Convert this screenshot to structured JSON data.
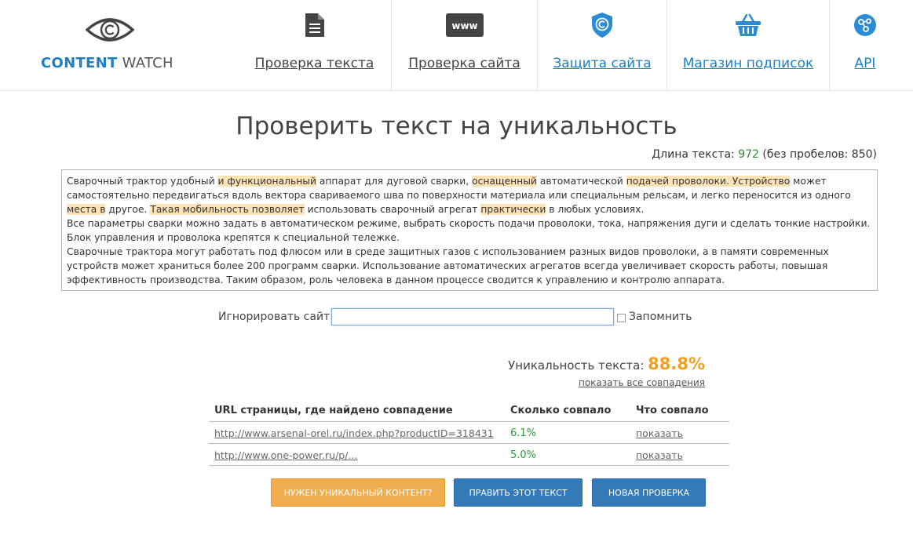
{
  "logo": {
    "part1": "CONTENT",
    "part2": " WATCH"
  },
  "nav": [
    {
      "label": "Проверка текста",
      "icon": "document-icon",
      "style": "dark"
    },
    {
      "label": "Проверка сайта",
      "icon": "www-icon",
      "style": "dark"
    },
    {
      "label": "Защита сайта",
      "icon": "shield-copyright-icon",
      "style": "blue"
    },
    {
      "label": "Магазин подписок",
      "icon": "basket-icon",
      "style": "blue"
    },
    {
      "label": "API",
      "icon": "api-nodes-icon",
      "style": "blue"
    }
  ],
  "page": {
    "title": "Проверить текст на уникальность",
    "length_label": "Длина текста: ",
    "length_value": "972",
    "length_nospace": " (без пробелов: 850)"
  },
  "text_segments": [
    {
      "t": "Сварочный трактор удобный ",
      "hl": false
    },
    {
      "t": "и функциональный",
      "hl": true
    },
    {
      "t": " аппарат для дуговой сварки, ",
      "hl": false
    },
    {
      "t": "оснащенный",
      "hl": true
    },
    {
      "t": " автоматической ",
      "hl": false
    },
    {
      "t": "подачей проволоки. Устройство",
      "hl": true
    },
    {
      "t": " может самостоятельно передвигаться вдоль вектора свариваемого шва по поверхности материала или специальным рельсам, и легко переносится из одного ",
      "hl": false
    },
    {
      "t": "места в",
      "hl": true
    },
    {
      "t": " другое. ",
      "hl": false
    },
    {
      "t": "Такая мобильность позволяет",
      "hl": true
    },
    {
      "t": " использовать сварочный агрегат ",
      "hl": false
    },
    {
      "t": "практически",
      "hl": true
    },
    {
      "t": " в любых условиях.\nВсе параметры сварки можно задать в автоматическом режиме, выбрать скорость подачи проволоки, тока, напряжения дуги и сделать тонкие настройки. Блок управления и проволока крепятся к специальной тележке.\nСварочные трактора могут работать под флюсом или в среде защитных газов с использованием разных видов проволоки, а в памяти современных устройств может храниться более 200 программ сварки. Использование автоматических агрегатов всегда увеличивает скорость работы, повышая эффективность производства. Таким образом, роль человека в данном процессе сводится к управлению и контролю аппарата.",
      "hl": false
    }
  ],
  "ignore": {
    "label": "Игнорировать сайт:",
    "value": "",
    "remember_label": "Запомнить",
    "remember_checked": false
  },
  "uniqueness": {
    "label": "Уникальность текста: ",
    "value": "88.8%",
    "show_all": "показать все совпадения"
  },
  "matches": {
    "headers": [
      "URL страницы, где найдено совпадение",
      "Сколько совпало",
      "Что совпало"
    ],
    "rows": [
      {
        "url": "http://www.arsenal-orel.ru/index.php?productID=318431",
        "percent": "6.1%",
        "action": "показать"
      },
      {
        "url": "http://www.one-power.ru/p/...",
        "percent": "5.0%",
        "action": "показать"
      }
    ]
  },
  "buttons": {
    "need_content": "Нужен уникальный контент?",
    "edit_text": "Править этот текст",
    "new_check": "Новая проверка"
  },
  "colors": {
    "brand_blue": "#1d7fc4",
    "highlight": "#fde3b6",
    "uniqueness": "#f0a020",
    "match_green": "#2e9a3c",
    "button_orange": "#f0ad4e",
    "button_blue": "#337ab7"
  }
}
